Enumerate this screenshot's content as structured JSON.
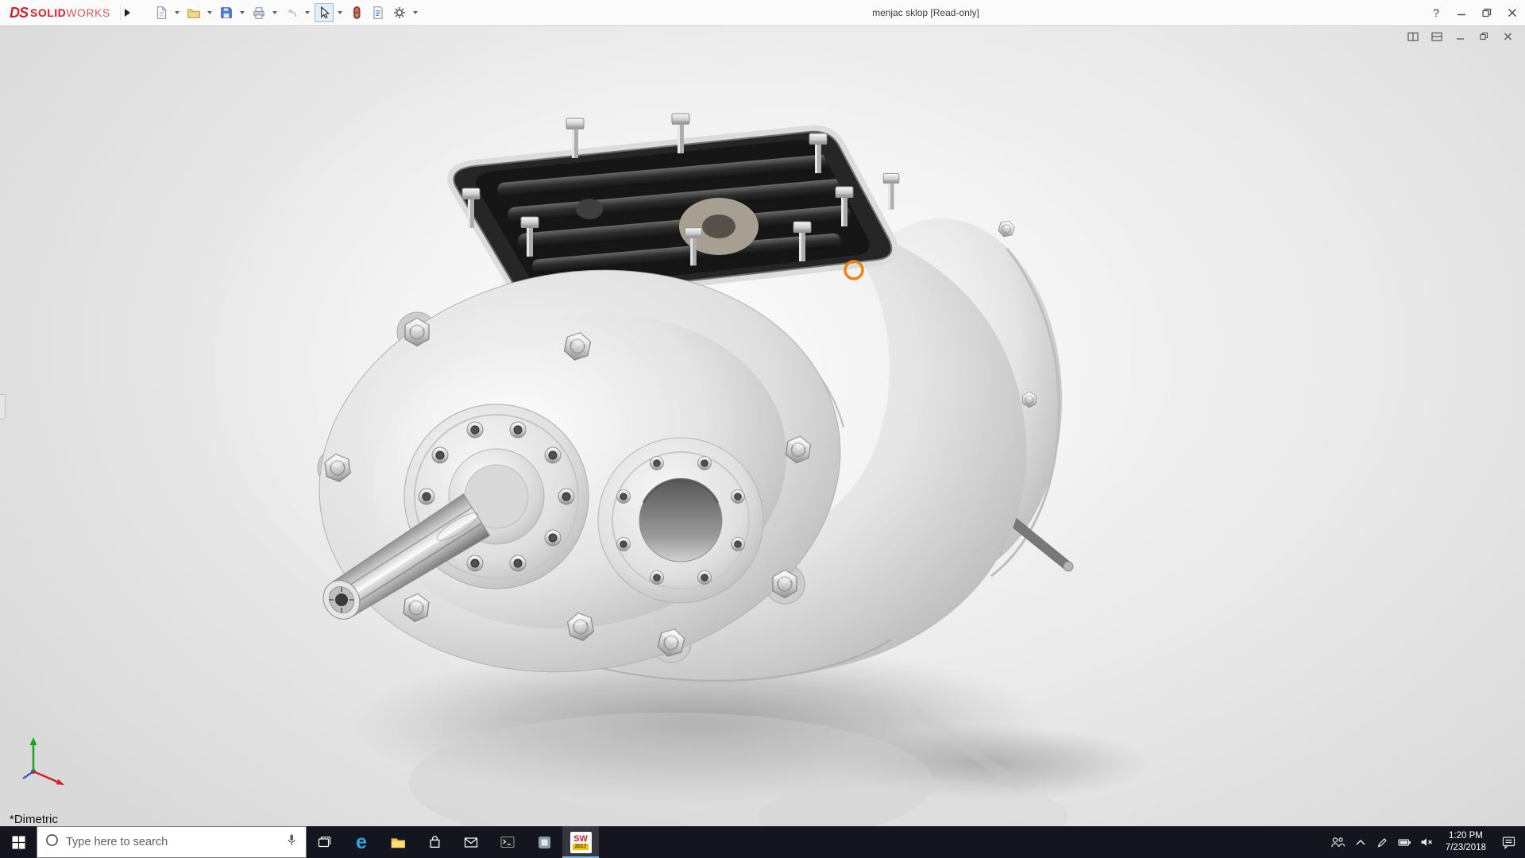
{
  "titlebar": {
    "brand_prefix": "DS",
    "brand_bold": "SOLID",
    "brand_light": "WORKS",
    "title": "menjac sklop [Read-only]",
    "help_label": "?",
    "toolbar_icons": [
      "new-document",
      "open",
      "save",
      "print",
      "undo",
      "select",
      "rebuild",
      "file-properties",
      "options"
    ]
  },
  "document_window": {
    "controls": [
      "restore-pane",
      "split-pane",
      "minimize",
      "restore",
      "close"
    ]
  },
  "viewport": {
    "view_orientation": "*Dimetric",
    "selection_highlight_color": "#e8840f"
  },
  "taskbar": {
    "search_placeholder": "Type here to search",
    "edge_glyph": "e",
    "solidworks_badge": {
      "sw": "SW",
      "year": "2017"
    },
    "clock": {
      "time": "1:20 PM",
      "date": "7/23/2018"
    },
    "pinned_icons": [
      "start",
      "search",
      "task-view",
      "edge",
      "file-explorer",
      "store",
      "mail",
      "terminal",
      "pinned-app",
      "solidworks-2017"
    ],
    "tray_icons": [
      "people",
      "hidden-icons-chevron",
      "pen",
      "battery",
      "volume-muted",
      "action-center"
    ]
  },
  "colors": {
    "brand_red": "#d2232a",
    "taskbar_bg": "#15151f",
    "taskbar_active_accent": "#76b9ed",
    "selection_orange": "#e8840f"
  }
}
